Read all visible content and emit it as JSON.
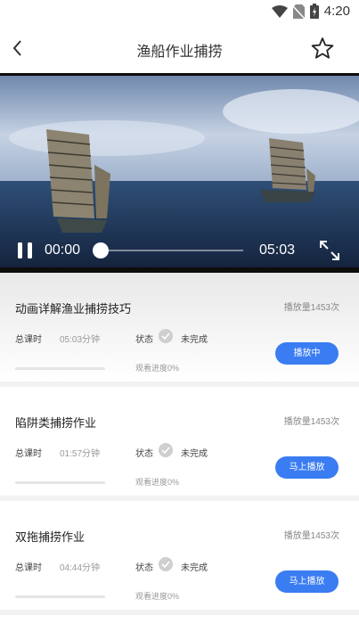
{
  "status_bar": {
    "time": "4:20"
  },
  "header": {
    "title": "渔船作业捕捞"
  },
  "player": {
    "current_time": "00:00",
    "total_time": "05:03",
    "progress": 0
  },
  "lessons": [
    {
      "title": "动画详解渔业捕捞技巧",
      "views": "播放量1453次",
      "total_label": "总课时",
      "duration": "05:03分钟",
      "state_label": "状态",
      "status": "未完成",
      "progress_text": "观看进度0%",
      "button": "播放中"
    },
    {
      "title": "陷阱类捕捞作业",
      "views": "播放量1453次",
      "total_label": "总课时",
      "duration": "01:57分钟",
      "state_label": "状态",
      "status": "未完成",
      "progress_text": "观看进度0%",
      "button": "马上播放"
    },
    {
      "title": "双拖捕捞作业",
      "views": "播放量1453次",
      "total_label": "总课时",
      "duration": "04:44分钟",
      "state_label": "状态",
      "status": "未完成",
      "progress_text": "观看进度0%",
      "button": "马上播放"
    }
  ],
  "colors": {
    "accent": "#3a7cf2"
  }
}
